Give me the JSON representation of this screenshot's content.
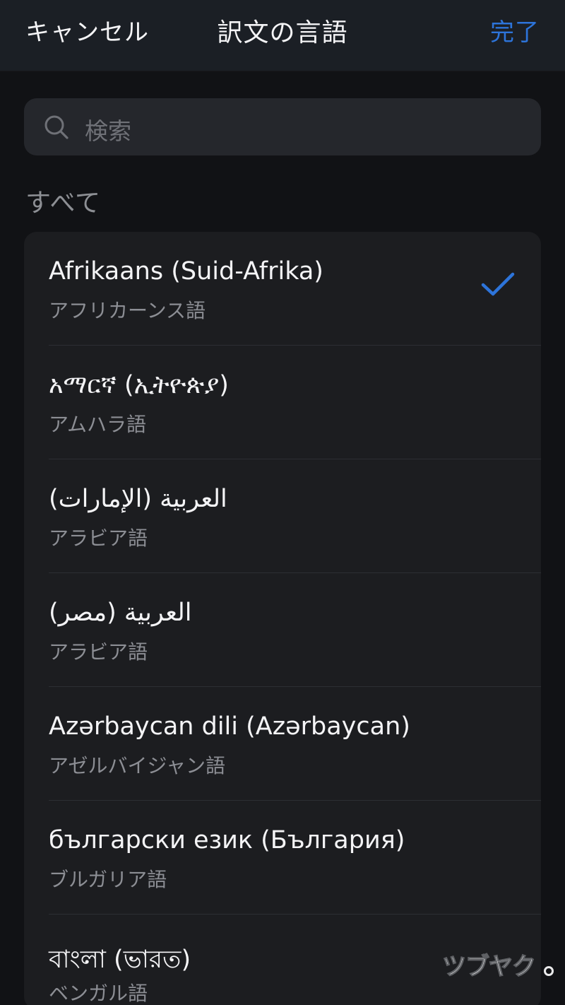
{
  "header": {
    "cancel_label": "キャンセル",
    "title": "訳文の言語",
    "done_label": "完了"
  },
  "search": {
    "placeholder": "検索"
  },
  "section": {
    "title": "すべて"
  },
  "languages": [
    {
      "primary": "Afrikaans (Suid-Afrika)",
      "secondary": "アフリカーンス語",
      "selected": true
    },
    {
      "primary": "አማርኛ (ኢትዮጵያ)",
      "secondary": "アムハラ語",
      "selected": false
    },
    {
      "primary": "العربية (الإمارات)",
      "secondary": "アラビア語",
      "selected": false
    },
    {
      "primary": "العربية (مصر)",
      "secondary": "アラビア語",
      "selected": false
    },
    {
      "primary": "Azərbaycan dili (Azərbaycan)",
      "secondary": "アゼルバイジャン語",
      "selected": false
    },
    {
      "primary": "български език (България)",
      "secondary": "ブルガリア語",
      "selected": false
    },
    {
      "primary": "বাংলা (ভারত)",
      "secondary": "ベンガル語",
      "selected": false
    }
  ],
  "colors": {
    "accent": "#2d74da",
    "background": "#111215",
    "list_background": "#1c1d20",
    "secondary_text": "#8c8e94"
  },
  "watermark": {
    "text": "ツブヤク。"
  }
}
